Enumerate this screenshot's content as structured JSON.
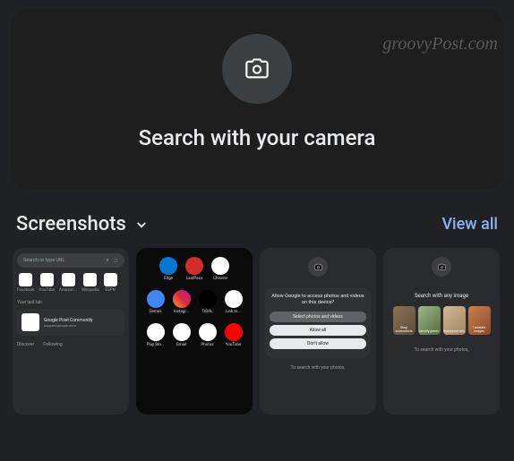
{
  "watermark": "groovyPost.com",
  "hero": {
    "title": "Search with your camera"
  },
  "section": {
    "title": "Screenshots",
    "viewAll": "View all"
  },
  "shot1": {
    "search": "Search or type URL",
    "icons": [
      "Facebook",
      "YouTube",
      "Amazon...",
      "Wikipedia",
      "ESPN"
    ],
    "lastTab": "Your last tab",
    "cardTitle": "Google Pixel Community",
    "cardSub": "support.google.com",
    "tabs": [
      "Discover",
      "Following"
    ]
  },
  "shot2": {
    "r1": [
      "Edge",
      "LastPass",
      "Chrome"
    ],
    "r2": [
      "Gemini",
      "Instagr...",
      "TIDAL",
      "Link to..."
    ],
    "r3": [
      "Play Sto...",
      "Gmail",
      "Photos",
      "YouTube"
    ],
    "colors": {
      "Edge": "#0078d4",
      "LastPass": "#d32d27",
      "Chrome": "#fff",
      "Gemini": "#4285f4",
      "Instagr...": "linear-gradient(45deg,#f09433,#e6683c,#dc2743,#cc2366,#bc1888)",
      "TIDAL": "#000",
      "Link to...": "#fff",
      "Play Sto...": "#fff",
      "Gmail": "#fff",
      "Photos": "#fff",
      "YouTube": "#ff0000"
    }
  },
  "shot3": {
    "dialogTitle": "Allow Google to access photos and videos on this device?",
    "btns": [
      "Select photos and videos",
      "Allow all",
      "Don't allow"
    ],
    "footer": "To search with your photos,"
  },
  "shot4": {
    "heading": "Search with any image",
    "tiles": [
      "Shop screenshots",
      "Identify plants",
      "Homework help",
      "Translate images"
    ],
    "footer": "To search with your photos,"
  }
}
